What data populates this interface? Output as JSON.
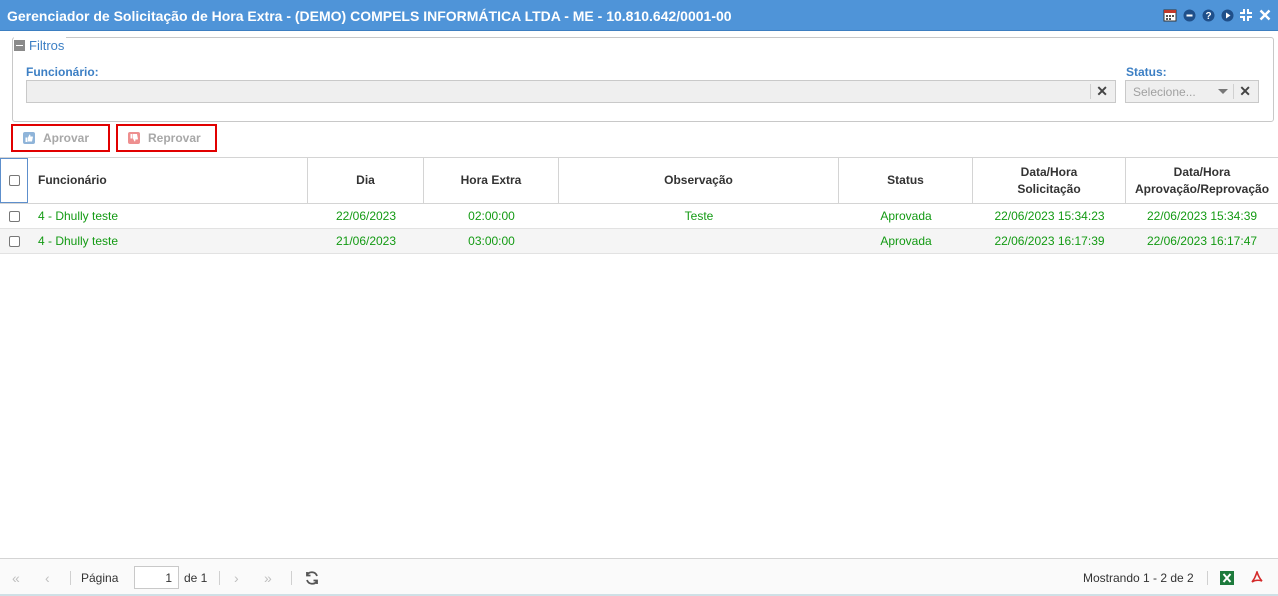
{
  "window": {
    "title": "Gerenciador de Solicitação de Hora Extra - (DEMO) COMPELS INFORMÁTICA LTDA - ME - 10.810.642/0001-00",
    "tools": [
      "calendar-icon",
      "minimize-icon",
      "help-icon",
      "play-icon",
      "restore-icon",
      "close-icon"
    ]
  },
  "filters": {
    "legend": "Filtros",
    "funcionario_label": "Funcionário:",
    "funcionario_value": "",
    "status_label": "Status:",
    "status_placeholder": "Selecione..."
  },
  "actions": {
    "approve_label": "Aprovar",
    "reject_label": "Reprovar"
  },
  "grid": {
    "headers": {
      "funcionario": "Funcionário",
      "dia": "Dia",
      "hora_extra": "Hora Extra",
      "observacao": "Observação",
      "status": "Status",
      "solicitacao_1": "Data/Hora",
      "solicitacao_2": "Solicitação",
      "aprovacao_1": "Data/Hora",
      "aprovacao_2": "Aprovação/Reprovação"
    },
    "rows": [
      {
        "funcionario": "4 - Dhully teste",
        "dia": "22/06/2023",
        "hora_extra": "02:00:00",
        "observacao": "Teste",
        "status": "Aprovada",
        "solicitacao": "22/06/2023 15:34:23",
        "aprovacao": "22/06/2023 15:34:39"
      },
      {
        "funcionario": "4 - Dhully teste",
        "dia": "21/06/2023",
        "hora_extra": "03:00:00",
        "observacao": "",
        "status": "Aprovada",
        "solicitacao": "22/06/2023 16:17:39",
        "aprovacao": "22/06/2023 16:17:47"
      }
    ]
  },
  "pager": {
    "page_label": "Página",
    "page_value": "1",
    "of_label": "de 1",
    "showing": "Mostrando 1 - 2 de 2"
  },
  "colors": {
    "title_bar": "#4f94d8",
    "label_blue": "#3c7fc4",
    "row_text_green": "#139a13",
    "highlight_red": "#e10000"
  }
}
